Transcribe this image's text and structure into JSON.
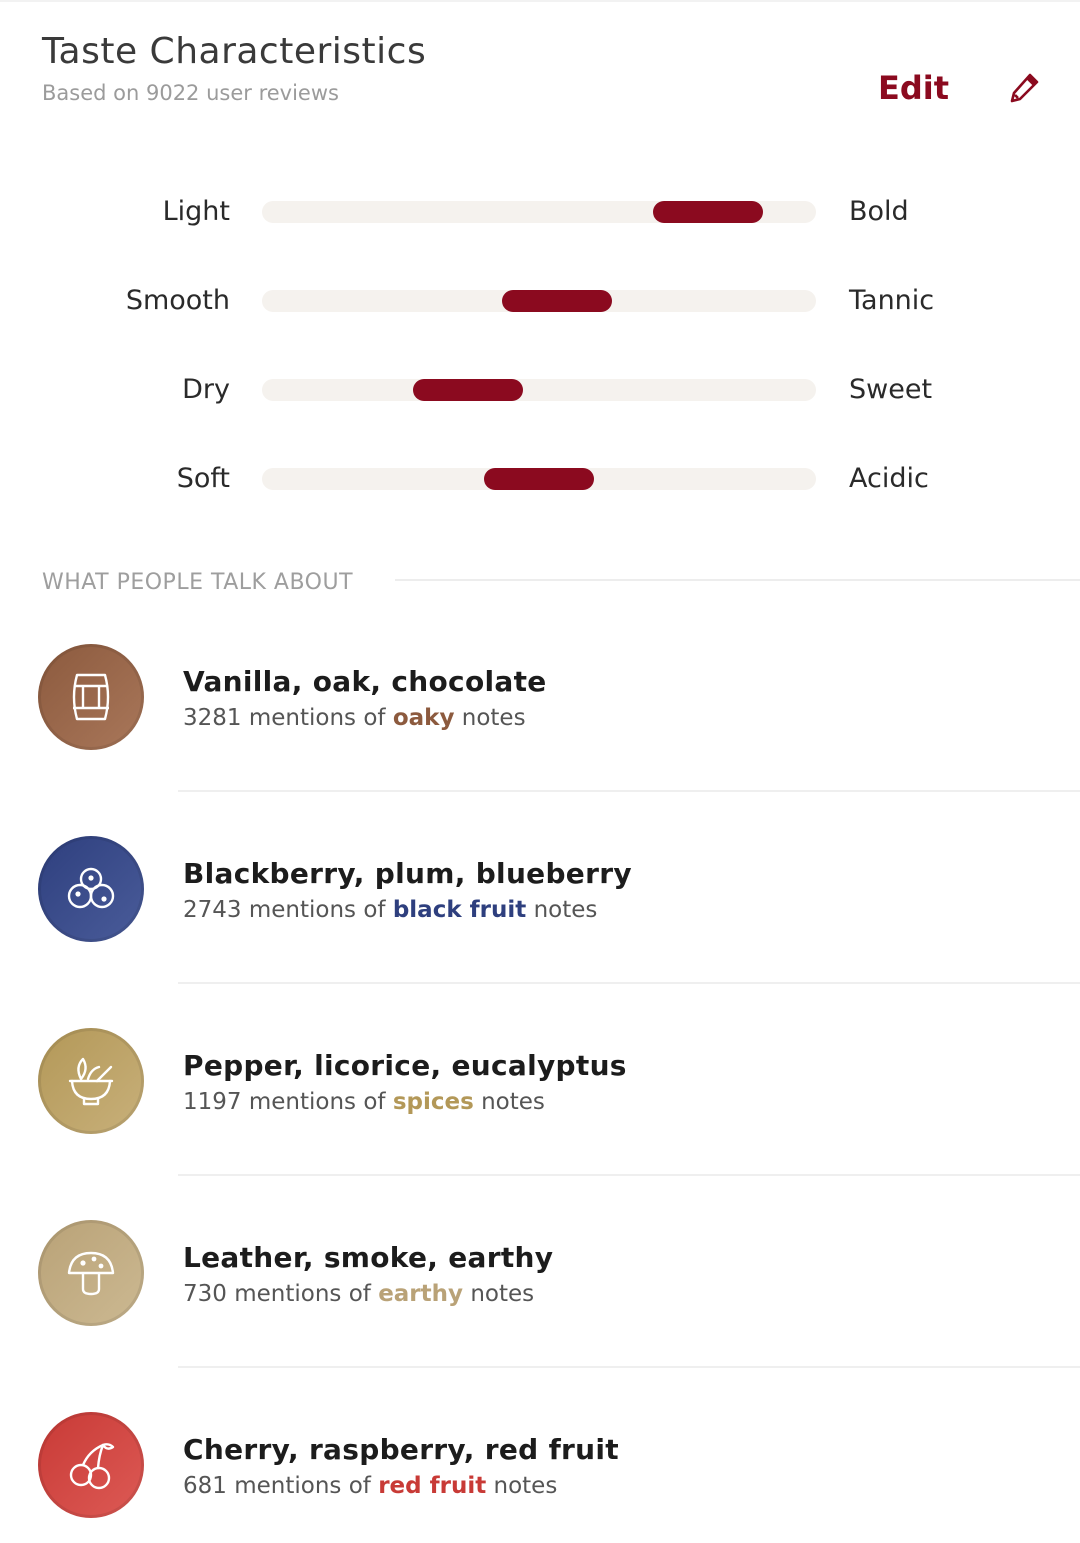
{
  "header": {
    "title": "Taste Characteristics",
    "subtitle": "Based on 9022 user reviews",
    "edit_label": "Edit",
    "edit_icon": "pencil-icon"
  },
  "colors": {
    "accent": "#8b0a1f",
    "track": "#f5f2ee"
  },
  "scales": [
    {
      "left": "Light",
      "right": "Bold",
      "level": 0.88
    },
    {
      "left": "Smooth",
      "right": "Tannic",
      "level": 0.54
    },
    {
      "left": "Dry",
      "right": "Sweet",
      "level": 0.34
    },
    {
      "left": "Soft",
      "right": "Acidic",
      "level": 0.5
    }
  ],
  "section": {
    "label": "WHAT PEOPLE TALK ABOUT"
  },
  "flavors": [
    {
      "title": "Vanilla, oak, chocolate",
      "count": "3281",
      "pre": "mentions of",
      "highlight": "oaky",
      "post": "notes",
      "icon": "barrel-icon",
      "color": "#8c5a3e",
      "color2": "#a9775a"
    },
    {
      "title": "Blackberry, plum, blueberry",
      "count": "2743",
      "pre": "mentions of",
      "highlight": "black fruit",
      "post": "notes",
      "icon": "berries-icon",
      "color": "#2e3f7e",
      "color2": "#4a5c9a"
    },
    {
      "title": "Pepper, licorice, eucalyptus",
      "count": "1197",
      "pre": "mentions of",
      "highlight": "spices",
      "post": "notes",
      "icon": "mortar-icon",
      "color": "#b39858",
      "color2": "#c8b07a"
    },
    {
      "title": "Leather, smoke, earthy",
      "count": "730",
      "pre": "mentions of",
      "highlight": "earthy",
      "post": "notes",
      "icon": "mushroom-icon",
      "color": "#b9a277",
      "color2": "#ccb992"
    },
    {
      "title": "Cherry, raspberry, red fruit",
      "count": "681",
      "pre": "mentions of",
      "highlight": "red fruit",
      "post": "notes",
      "icon": "cherry-icon",
      "color": "#c83a36",
      "color2": "#dd5a55"
    }
  ]
}
